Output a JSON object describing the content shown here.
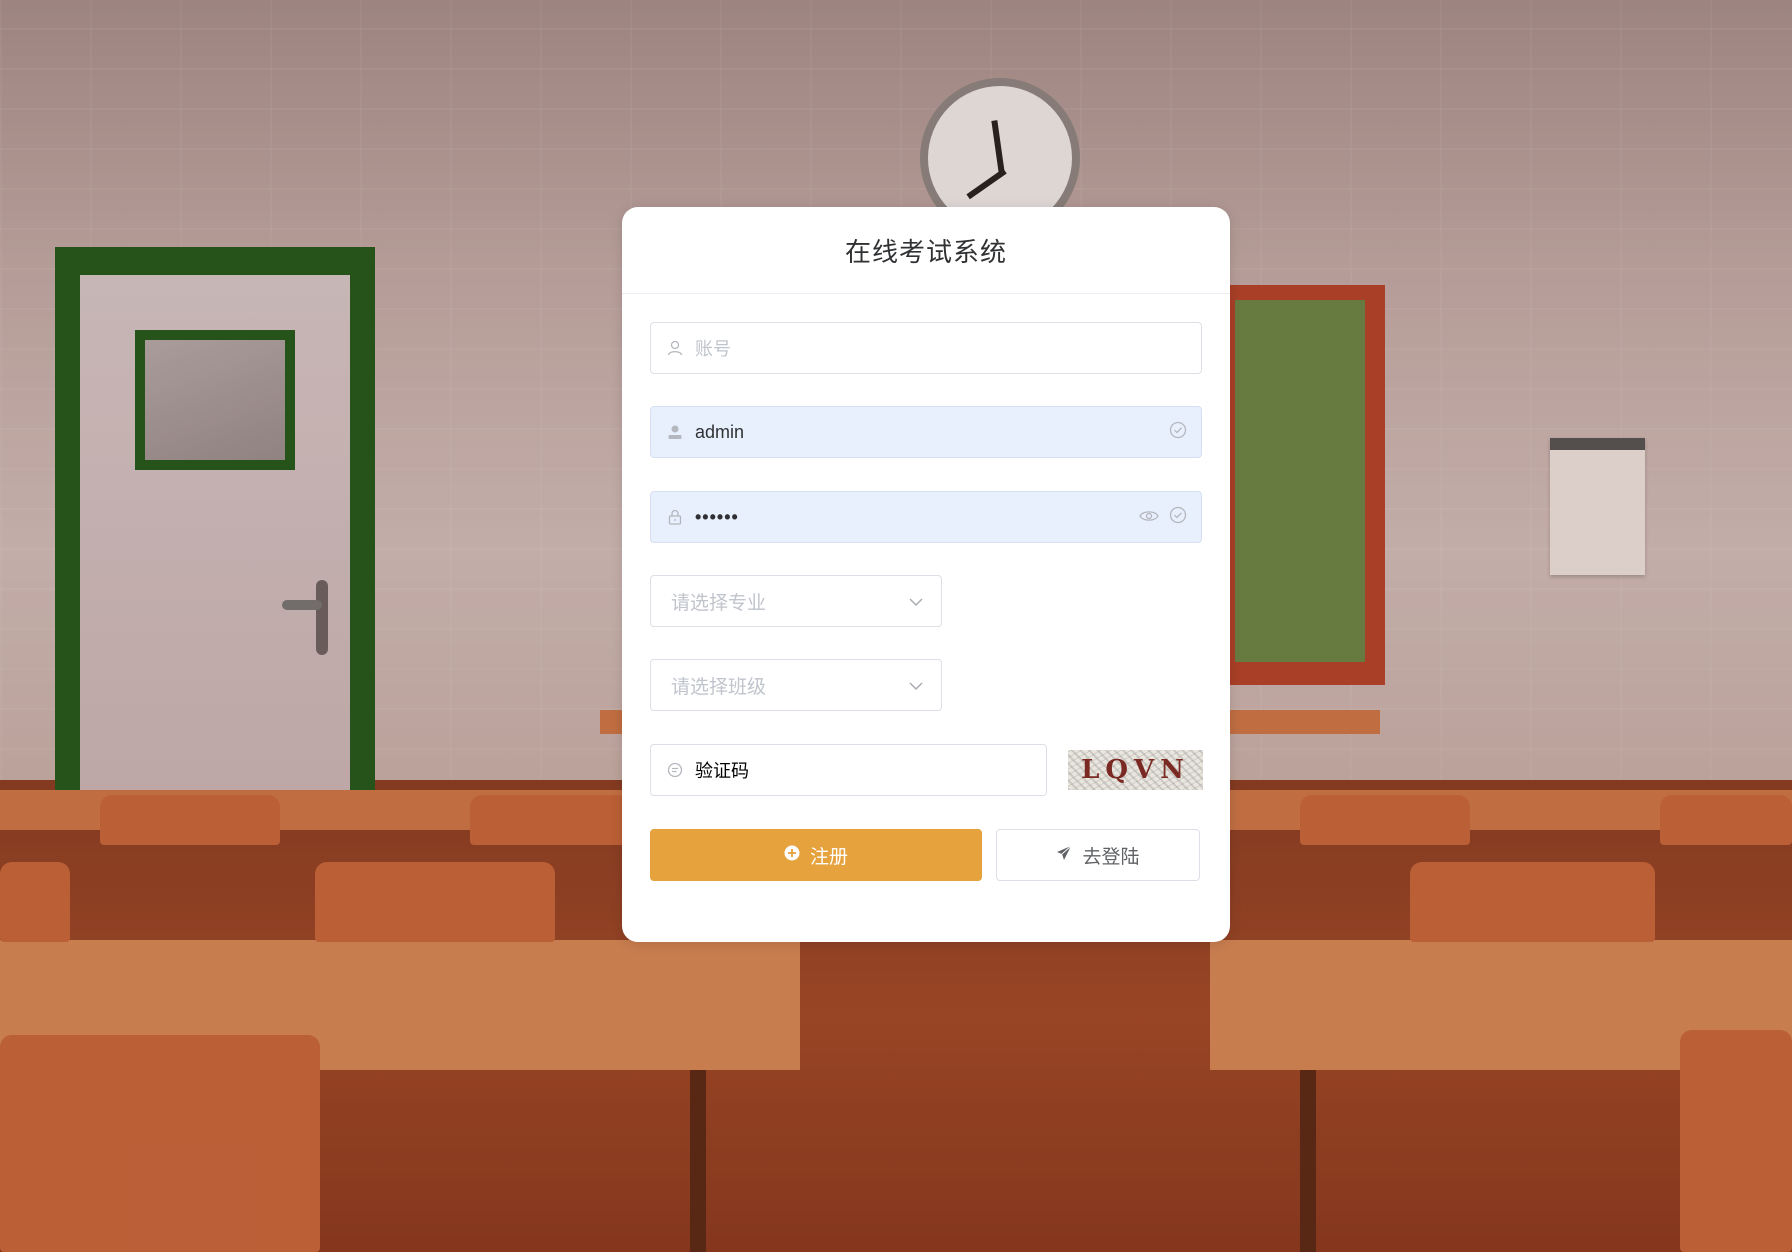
{
  "title": "在线考试系统",
  "form": {
    "account": {
      "placeholder": "账号",
      "value": ""
    },
    "username": {
      "value": "admin"
    },
    "password": {
      "value": "••••••"
    },
    "major_select": {
      "placeholder": "请选择专业"
    },
    "class_select": {
      "placeholder": "请选择班级"
    },
    "captcha": {
      "placeholder": "验证码",
      "image_text": "LQVN"
    }
  },
  "buttons": {
    "register": "注册",
    "go_login": "去登陆"
  },
  "colors": {
    "primary": "#e6a23c",
    "autofill_bg": "#e8f0fe",
    "placeholder": "#c0c4cc",
    "border": "#dcdfe6"
  },
  "icons": {
    "account": "user-outline-icon",
    "username": "user-solid-icon",
    "password": "lock-icon",
    "captcha": "chat-icon",
    "register": "circle-plus-icon",
    "go_login": "send-icon",
    "select": "chevron-down-icon",
    "valid": "circle-check-icon",
    "show_password": "eye-icon"
  }
}
